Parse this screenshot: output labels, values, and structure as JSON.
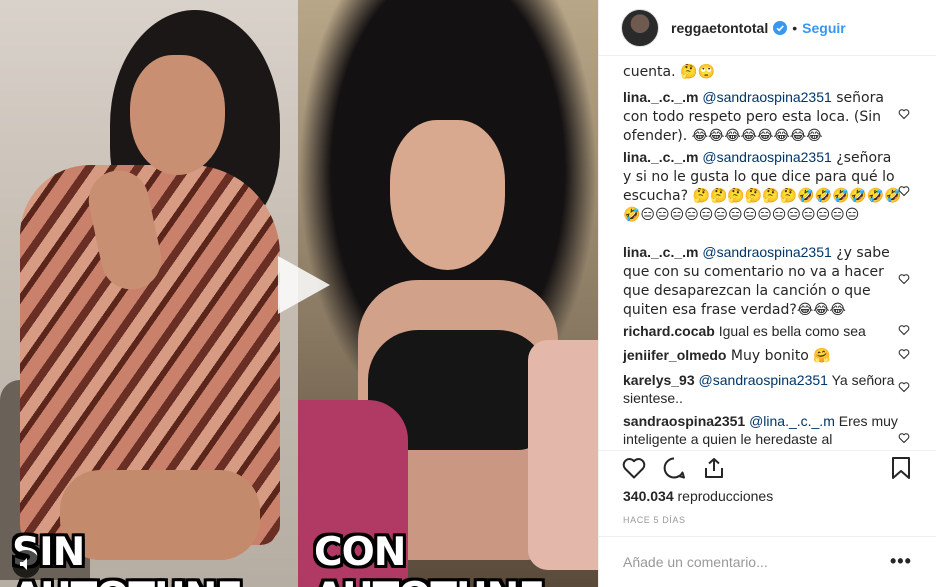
{
  "video": {
    "caption_left": "SIN AUTOTUNE",
    "caption_right": "CON AUTOTUNE"
  },
  "header": {
    "username": "reggaetontotal",
    "separator": "•",
    "follow_label": "Seguir"
  },
  "comments": [
    {
      "user": "",
      "mention": "",
      "text": "cuenta. 🤔🙄"
    },
    {
      "user": "lina._.c._.m",
      "mention": "@sandraospina2351",
      "text": " señora con todo respeto pero esta loca. (Sin ofender). 😂😂😂😂😂😂😂😂"
    },
    {
      "user": "lina._.c._.m",
      "mention": "@sandraospina2351",
      "text": " ¿señora y si no le gusta lo que dice para qué lo escucha? 🤔🤔🤔🤔🤔🤔🤣🤣🤣🤣🤣🤣🤣😑😑😑😑😑😑😑😑😑😑😑😑😑😑😑"
    },
    {
      "user": "lina._.c._.m",
      "mention": "@sandraospina2351",
      "text": " ¿y sabe que con su comentario no va a hacer que desaparezcan la canción o que quiten esa frase verdad?😂😂😂"
    },
    {
      "user": "richard.cocab",
      "mention": "",
      "text": " Igual es bella como sea"
    },
    {
      "user": "jeniifer_olmedo",
      "mention": "",
      "text": " Muy bonito 🤗"
    },
    {
      "user": "karelys_93",
      "mention": "@sandraospina2351",
      "text": " Ya señora sientese.."
    },
    {
      "user": "sandraospina2351",
      "mention": "@lina._.c._.m",
      "text": " Eres muy inteligente a quien le heredaste al"
    }
  ],
  "stats": {
    "views_count": "340.034",
    "views_label": " reproducciones",
    "time_ago": "HACE 5 DÍAS"
  },
  "add_comment": {
    "placeholder": "Añade un comentario...",
    "more": "•••"
  },
  "icons": {
    "like": "heart-icon",
    "comment": "comment-icon",
    "share": "share-icon",
    "save": "bookmark-icon",
    "play": "play-icon",
    "audio": "speaker-icon",
    "verified": "verified-badge-icon"
  },
  "colors": {
    "link": "#3897f0",
    "mention": "#003569",
    "verified": "#3897f0"
  }
}
